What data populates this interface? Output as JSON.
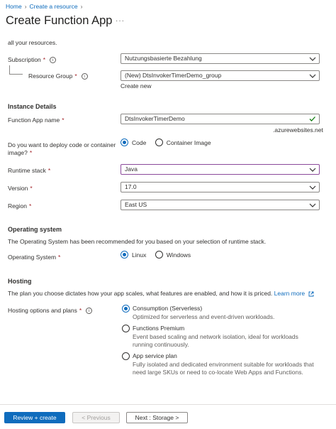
{
  "breadcrumb": {
    "home": "Home",
    "create_resource": "Create a resource"
  },
  "header": {
    "title": "Create Function App",
    "more": "···"
  },
  "intro_text": "all your resources.",
  "subscription": {
    "label": "Subscription",
    "value": "Nutzungsbasierte Bezahlung"
  },
  "resource_group": {
    "label": "Resource Group",
    "value": "(New) DtsInvokerTimerDemo_group",
    "create_new": "Create new"
  },
  "instance": {
    "heading": "Instance Details",
    "app_name_label": "Function App name",
    "app_name_value": "DtsInvokerTimerDemo",
    "domain_suffix": ".azurewebsites.net",
    "deploy_question_line1": "Do you want to deploy code or container",
    "deploy_question_line2": "image?",
    "deploy_options": [
      "Code",
      "Container Image"
    ],
    "deploy_selected": "Code",
    "runtime_label": "Runtime stack",
    "runtime_value": "Java",
    "version_label": "Version",
    "version_value": "17.0",
    "region_label": "Region",
    "region_value": "East US"
  },
  "os": {
    "heading": "Operating system",
    "description": "The Operating System has been recommended for you based on your selection of runtime stack.",
    "label": "Operating System",
    "options": [
      "Linux",
      "Windows"
    ],
    "selected": "Linux"
  },
  "hosting": {
    "heading": "Hosting",
    "description": "The plan you choose dictates how your app scales, what features are enabled, and how it is priced.",
    "learn_more": "Learn more",
    "label": "Hosting options and plans",
    "plans": [
      {
        "name": "Consumption (Serverless)",
        "desc1": "Optimized for serverless and event-driven workloads.",
        "desc2": ""
      },
      {
        "name": "Functions Premium",
        "desc1": "Event based scaling and network isolation, ideal for workloads",
        "desc2": "running continuously."
      },
      {
        "name": "App service plan",
        "desc1": "Fully isolated and dedicated environment suitable for workloads that",
        "desc2": "need large SKUs or need to co-locate Web Apps and Functions."
      }
    ],
    "selected": "Consumption (Serverless)"
  },
  "footer": {
    "review_create": "Review + create",
    "previous": "< Previous",
    "next": "Next : Storage >"
  },
  "colors": {
    "accent": "#0f6cbd",
    "required": "#a4262c",
    "valid": "#107c10",
    "focus_border": "#8b4a9b"
  }
}
